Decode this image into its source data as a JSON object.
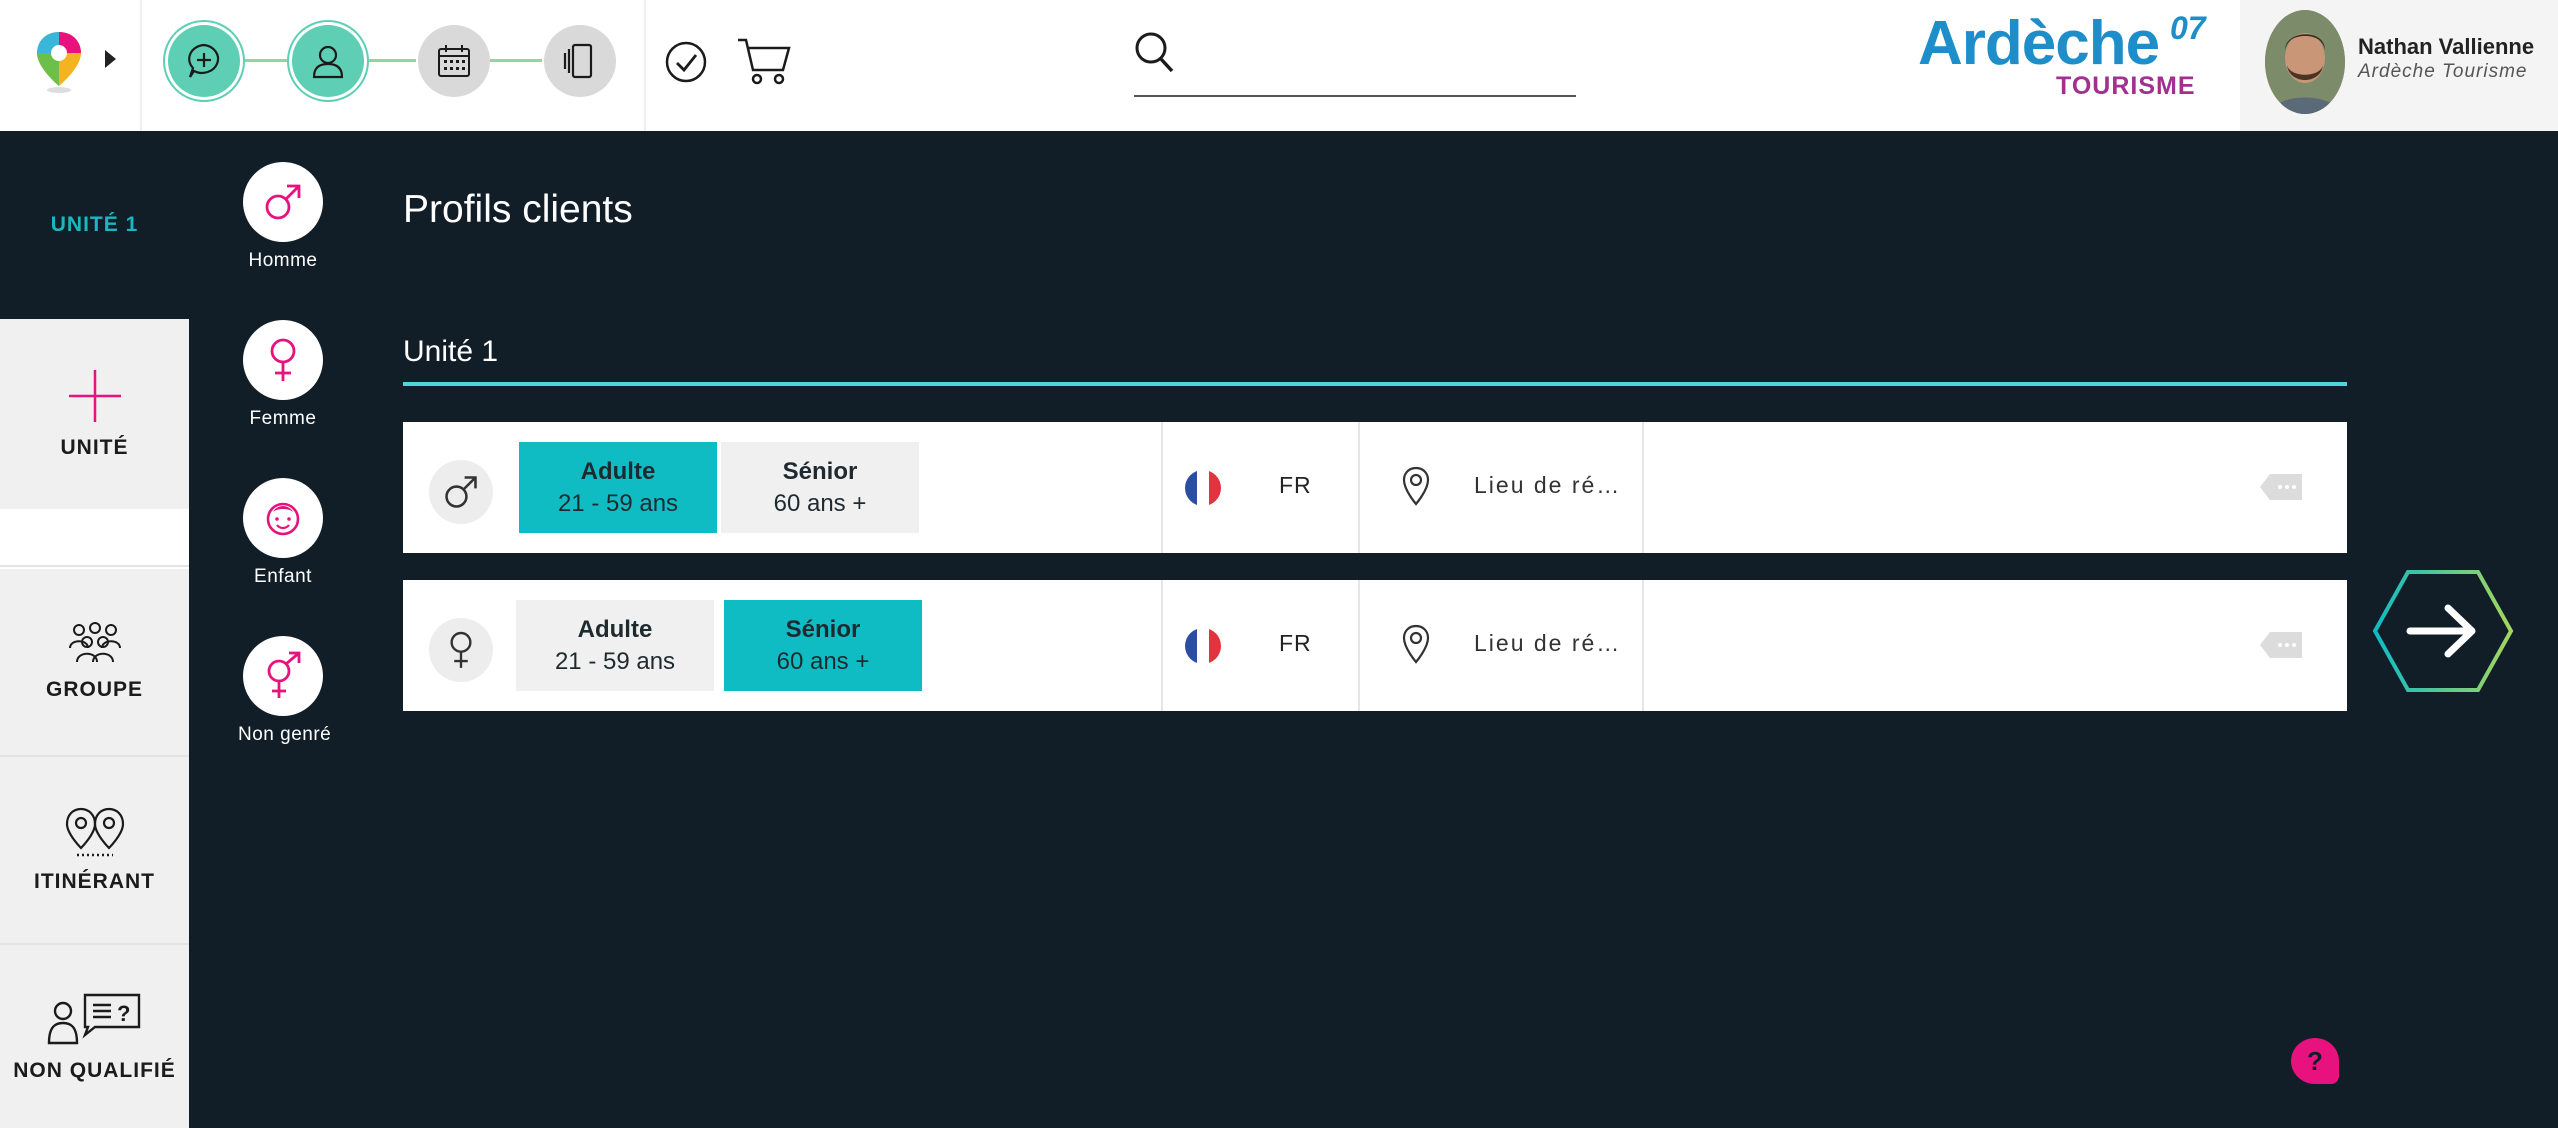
{
  "header": {
    "steps": [
      {
        "name": "add-icon",
        "state": "done"
      },
      {
        "name": "user-icon",
        "state": "done"
      },
      {
        "name": "calendar-icon",
        "state": "todo"
      },
      {
        "name": "cards-icon",
        "state": "todo"
      }
    ],
    "search": {
      "value": "",
      "placeholder": ""
    },
    "brand": {
      "main": "Ardèche",
      "sup": "07",
      "sub": "TOURISME"
    },
    "user": {
      "name": "Nathan Vallienne",
      "org": "Ardèche Tourisme"
    }
  },
  "sidebar": {
    "unit_label": "UNITÉ 1",
    "items": [
      {
        "label": "UNITÉ",
        "icon": "plus-icon"
      },
      {
        "label": "GROUPE",
        "icon": "group-icon"
      },
      {
        "label": "ITINÉRANT",
        "icon": "itinerant-icon"
      },
      {
        "label": "NON QUALIFIÉ",
        "icon": "unqualified-icon"
      }
    ]
  },
  "genders": [
    {
      "label": "Homme",
      "icon": "male-icon"
    },
    {
      "label": "Femme",
      "icon": "female-icon"
    },
    {
      "label": "Enfant",
      "icon": "child-icon"
    },
    {
      "label": "Non genré",
      "icon": "nongender-icon"
    }
  ],
  "main": {
    "title": "Profils clients",
    "unit_name": "Unité 1",
    "rows": [
      {
        "gender_icon": "male-icon",
        "ages": [
          {
            "label": "Adulte",
            "range": "21 - 59 ans",
            "selected": true
          },
          {
            "label": "Sénior",
            "range": "60 ans +",
            "selected": false
          }
        ],
        "lang": "FR",
        "place": "Lieu de ré…"
      },
      {
        "gender_icon": "female-icon",
        "ages": [
          {
            "label": "Adulte",
            "range": "21 - 59 ans",
            "selected": false
          },
          {
            "label": "Sénior",
            "range": "60 ans +",
            "selected": true
          }
        ],
        "lang": "FR",
        "place": "Lieu de ré…"
      }
    ]
  },
  "help": {
    "label": "?"
  },
  "colors": {
    "accent": "#10bcc3",
    "pink": "#e8127e",
    "background": "#121e27",
    "step_done": "#5ecfb4",
    "brand_blue": "#1d8ec9",
    "brand_purple": "#a3308f"
  }
}
